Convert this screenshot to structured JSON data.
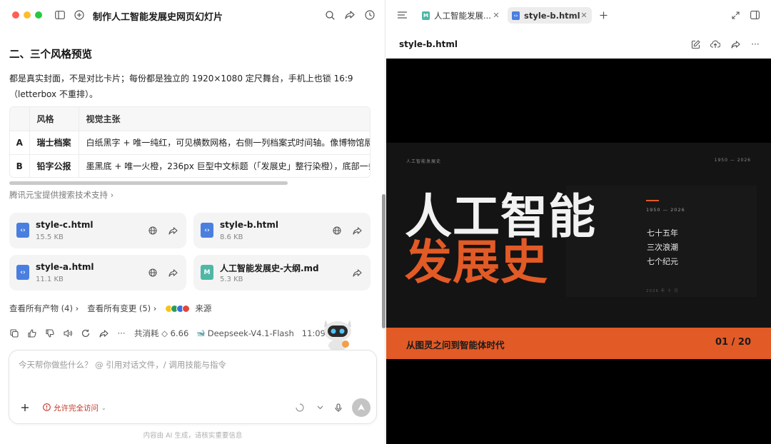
{
  "left": {
    "title": "制作人工智能发展史网页幻灯片",
    "section_heading": "二、三个风格预览",
    "paragraph": "都是真实封面，不是对比卡片；每份都是独立的 1920×1080 定尺舞台，手机上也锁 16:9（letterbox 不重排）。",
    "table": {
      "headers": [
        "",
        "风格",
        "视觉主张"
      ],
      "rows": [
        {
          "id": "A",
          "style": "瑞士档案",
          "vision": "白纸黑字 + 唯一纯红，可见横数网格，右侧一列档案式时间轴。像博物馆展陈，"
        },
        {
          "id": "B",
          "style": "铅字公报",
          "vision": "墨黑底 + 唯一火橙，236px 巨型中文标题（「发展史」整行染橙），底部一条橙"
        }
      ]
    },
    "source_note": "腾讯元宝提供搜索技术支持 ›",
    "files": [
      {
        "name": "style-c.html",
        "size": "15.5 KB",
        "type": "html"
      },
      {
        "name": "style-b.html",
        "size": "8.6 KB",
        "type": "html"
      },
      {
        "name": "style-a.html",
        "size": "11.1 KB",
        "type": "html"
      },
      {
        "name": "人工智能发展史-大纲.md",
        "size": "5.3 KB",
        "type": "md"
      }
    ],
    "links": {
      "artifacts": "查看所有产物 (4) ›",
      "changes": "查看所有变更 (5) ›",
      "source": "来源"
    },
    "action_bar": {
      "cost": "共消耗 ◇ 6.66",
      "model": "Deepseek-V4.1-Flash",
      "time": "11:09"
    },
    "composer": {
      "placeholder": "今天帮你做些什么？ @ 引用对话文件，/ 调用技能与指令",
      "access_label": "允许完全访问"
    },
    "disclaimer": "内容由 AI 生成，请核实重要信息"
  },
  "right": {
    "tabs": [
      {
        "label": "人工智能发展...",
        "active": false,
        "type": "md"
      },
      {
        "label": "style-b.html",
        "active": true,
        "type": "html"
      }
    ],
    "file_header": "style-b.html",
    "slide": {
      "top_left": "人工智能发展史",
      "top_right": "1950 — 2026",
      "title_line1": "人工智能",
      "title_line2": "发展史",
      "side_range": "1950 — 2026",
      "side_items": [
        "七十五年",
        "三次浪潮",
        "七个纪元"
      ],
      "side_foot": "2026 年 十 月",
      "band_text": "从图灵之问到智能体时代",
      "page": "01 / 20"
    }
  },
  "colors": {
    "accent_orange": "#e25a26",
    "slide_bg": "#141414",
    "danger_red": "#c0392b"
  },
  "icons": [
    "sidebar-toggle-icon",
    "new-chat-icon",
    "search-icon",
    "share-icon",
    "clock-icon",
    "globe-icon",
    "copy-icon",
    "like-icon",
    "dislike-icon",
    "speaker-icon",
    "refresh-icon",
    "more-icon",
    "plus-icon",
    "microphone-icon",
    "send-icon",
    "expand-icon",
    "panel-icon",
    "edit-icon",
    "upload-icon"
  ]
}
